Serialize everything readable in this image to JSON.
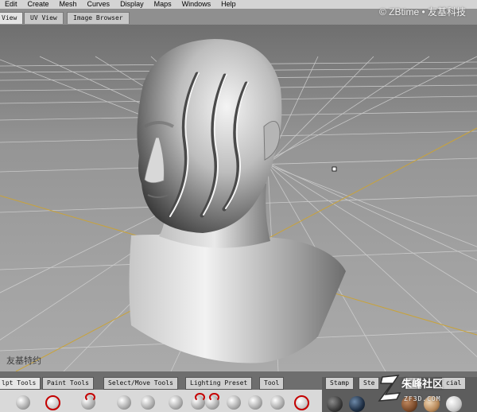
{
  "menubar": {
    "items": [
      "Edit",
      "Create",
      "Mesh",
      "Curves",
      "Display",
      "Maps",
      "Windows",
      "Help"
    ]
  },
  "watermark": {
    "top_right": "© ZBtime • 友基科技",
    "bottom_left": "友基特约",
    "brand_logo": "朱峰社区",
    "brand_url": "ZF3D.COM"
  },
  "view_tabs": [
    "View",
    "UV View",
    "Image Browser"
  ],
  "view_tabs_active": "View",
  "tool_tabs": [
    "lpt Tools",
    "Paint Tools",
    "Select/Move Tools",
    "Lighting Preset",
    "Tool"
  ],
  "tool_tabs_active": "lpt Tools",
  "right_tabs": [
    "Stamp",
    "Ste",
    "Ma",
    "cial"
  ],
  "tools": [
    "sculpt-tool",
    "smooth-tool",
    "grab-tool",
    "wax-tool",
    "flatten-tool",
    "pinch-tool",
    "imprint-tool",
    "knife-tool",
    "repeat-tool",
    "erase-tool",
    "amplify-tool",
    "spray-tool",
    "foamy-tool",
    "mask-tool",
    "extra-tool"
  ],
  "materials": [
    "#3a3a3a",
    "#1f2f44",
    "#7a4a2a",
    "#b98a5a",
    "#c8c8c8",
    "#e8e8e8"
  ],
  "colors": {
    "grid": "#cfcfcf",
    "axis": "#c9a33a",
    "accent_red": "#c40000"
  }
}
